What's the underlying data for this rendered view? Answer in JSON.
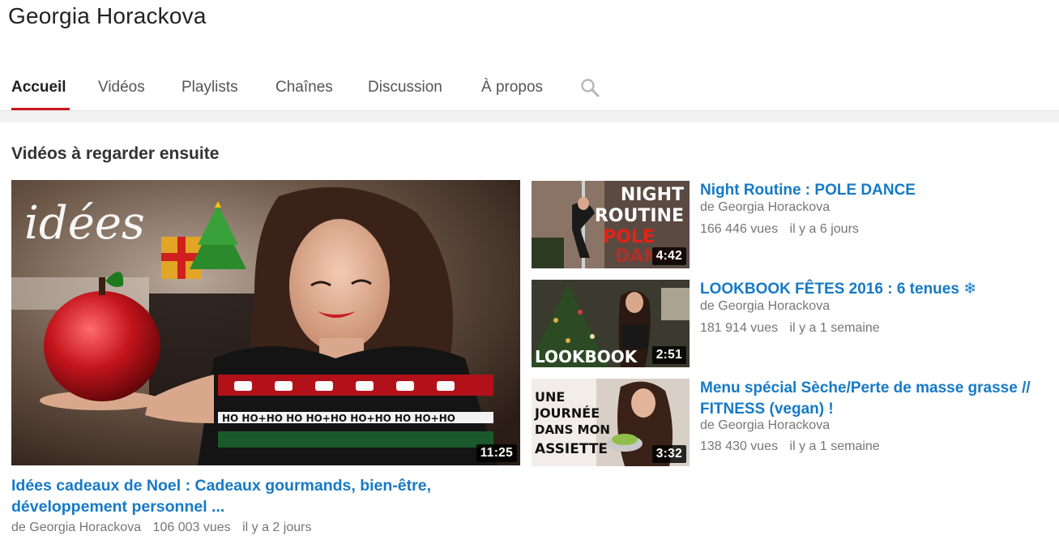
{
  "channel": {
    "title": "Georgia Horackova"
  },
  "tabs": [
    {
      "label": "Accueil",
      "active": true
    },
    {
      "label": "Vidéos",
      "active": false
    },
    {
      "label": "Playlists",
      "active": false
    },
    {
      "label": "Chaînes",
      "active": false
    },
    {
      "label": "Discussion",
      "active": false
    },
    {
      "label": "À propos",
      "active": false
    }
  ],
  "icons": {
    "search": "search-icon"
  },
  "colors": {
    "accent": "#cc181e",
    "link": "#167ac6",
    "meta": "#767676"
  },
  "section": {
    "title": "Vidéos à regarder ensuite"
  },
  "feature": {
    "title": "Idées cadeaux de Noel : Cadeaux gourmands, bien-être, développement personnel ...",
    "duration": "11:25",
    "channel": "de Georgia Horackova",
    "views": "106 003 vues",
    "age": "il y a 2 jours",
    "thumb_text": "idées",
    "sweater_text": "HO HO+HO HO HO+HO HO+HO HO HO+HO"
  },
  "side_videos": [
    {
      "title": "Night Routine : POLE DANCE",
      "duration": "4:42",
      "channel": "de Georgia Horackova",
      "views": "166 446 vues",
      "age": "il y a 6 jours",
      "thumb_lines": [
        "NIGHT",
        "ROUTINE",
        "POLE",
        "DANCE"
      ]
    },
    {
      "title": "LOOKBOOK FÊTES 2016 : 6 tenues ❄",
      "duration": "2:51",
      "channel": "de Georgia Horackova",
      "views": "181 914 vues",
      "age": "il y a 1 semaine",
      "thumb_lines": [
        "LOOKBOOK"
      ]
    },
    {
      "title": "Menu spécial Sèche/Perte de masse grasse // FITNESS (vegan) !",
      "duration": "3:32",
      "channel": "de Georgia Horackova",
      "views": "138 430 vues",
      "age": "il y a 1 semaine",
      "thumb_lines": [
        "UNE",
        "JOURNÉE",
        "DANS MON",
        "ASSIETTE"
      ]
    }
  ]
}
